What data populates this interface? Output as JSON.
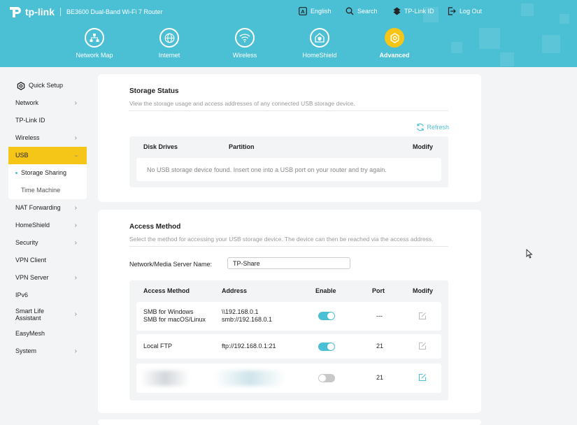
{
  "header": {
    "brand": "tp-link",
    "model": "BE3600 Dual-Band Wi-Fi 7 Router",
    "top_links": [
      {
        "label": "English",
        "icon": "language-icon"
      },
      {
        "label": "Search",
        "icon": "search-icon"
      },
      {
        "label": "TP-Link ID",
        "icon": "tplink-id-icon"
      },
      {
        "label": "Log Out",
        "icon": "logout-icon"
      }
    ],
    "main_nav": [
      {
        "label": "Network Map",
        "icon": "network-map-icon",
        "active": false
      },
      {
        "label": "Internet",
        "icon": "globe-icon",
        "active": false
      },
      {
        "label": "Wireless",
        "icon": "wifi-icon",
        "active": false
      },
      {
        "label": "HomeShield",
        "icon": "homeshield-icon",
        "active": false
      },
      {
        "label": "Advanced",
        "icon": "gear-icon",
        "active": true
      }
    ]
  },
  "sidebar": {
    "quick_setup": "Quick Setup",
    "items": [
      {
        "label": "Network",
        "chevron": true
      },
      {
        "label": "TP-Link ID",
        "chevron": false
      },
      {
        "label": "Wireless",
        "chevron": true
      },
      {
        "label": "USB",
        "chevron": true,
        "active": true
      },
      {
        "label": "NAT Forwarding",
        "chevron": true
      },
      {
        "label": "HomeShield",
        "chevron": true
      },
      {
        "label": "Security",
        "chevron": true
      },
      {
        "label": "VPN Client",
        "chevron": false
      },
      {
        "label": "VPN Server",
        "chevron": true
      },
      {
        "label": "IPv6",
        "chevron": false
      },
      {
        "label": "Smart Life",
        "label2": "Assistant",
        "chevron": true
      },
      {
        "label": "EasyMesh",
        "chevron": false
      },
      {
        "label": "System",
        "chevron": true
      }
    ],
    "usb_sub": [
      {
        "label": "Storage Sharing",
        "selected": true
      },
      {
        "label": "Time Machine",
        "selected": false
      }
    ]
  },
  "storage_status": {
    "title": "Storage Status",
    "description": "View the storage usage and access addresses of any connected USB storage device.",
    "refresh": "Refresh",
    "columns": [
      "Disk Drives",
      "Partition",
      "Modify"
    ],
    "empty_message": "No USB storage device found. Insert one into a USB port on your router and try again."
  },
  "access_method": {
    "title": "Access Method",
    "description": "Select the method for accessing your USB storage device. The device can then be reached via the access address.",
    "server_name_label": "Network/Media Server Name:",
    "server_name_value": "TP-Share",
    "columns": [
      "Access Method",
      "Address",
      "Enable",
      "Port",
      "Modify"
    ],
    "rows": [
      {
        "method1": "SMB for Windows",
        "method2": "SMB for macOS/Linux",
        "addr1": "\\\\192.168.0.1",
        "addr2": "smb://192.168.0.1",
        "enabled": true,
        "port": "---"
      },
      {
        "method1": "Local FTP",
        "method2": "",
        "addr1": "ftp://192.168.0.1:21",
        "addr2": "",
        "enabled": true,
        "port": "21"
      },
      {
        "method1": "",
        "method2": "",
        "addr1": "",
        "addr2": "",
        "enabled": false,
        "port": "21"
      }
    ]
  },
  "colors": {
    "header_bg": "#4bbfd4",
    "accent": "#4bbfd4",
    "active_yellow": "#f5c518"
  }
}
